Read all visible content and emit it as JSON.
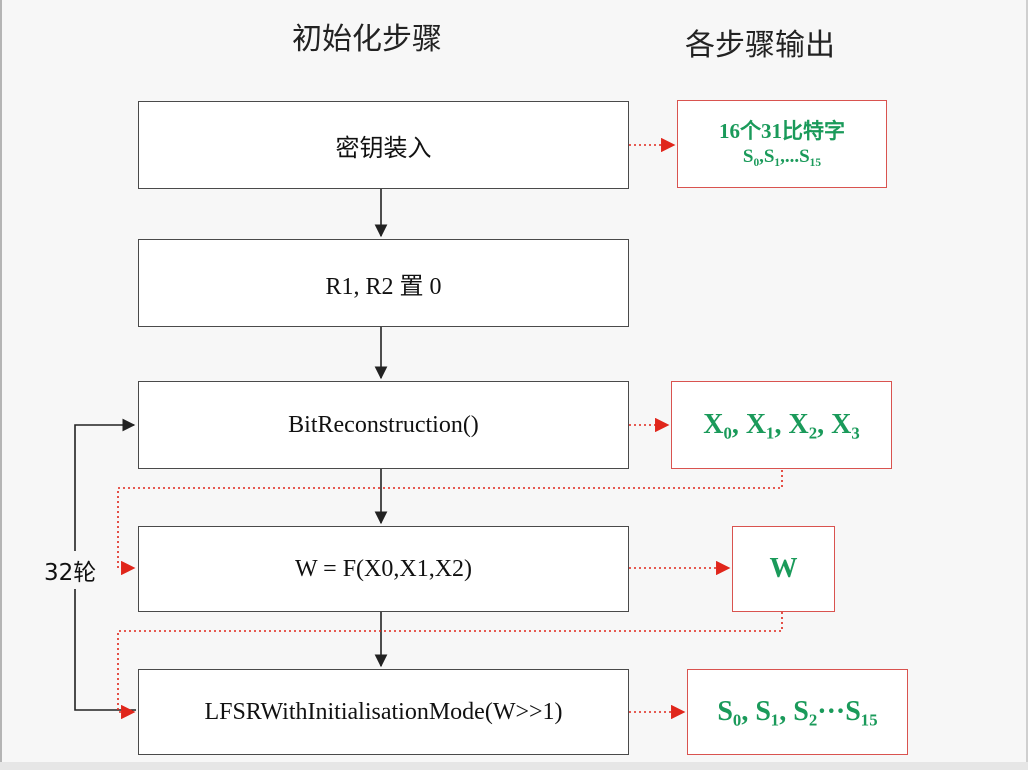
{
  "headings": {
    "steps": "初始化步骤",
    "outputs": "各步骤输出"
  },
  "steps": [
    "密钥装入",
    "R1, R2 置 0",
    "BitReconstruction()",
    "W = F(X0,X1,X2)",
    "LFSRWithInitialisationMode(W>>1)"
  ],
  "outputs": {
    "key_line1": "16个31比特字",
    "key_line2": "S₀,S₁,...S₁₅",
    "bits": "X₀, X₁, X₂, X₃",
    "w": "W",
    "lfsr": "S₀, S₁, S₂···S₁₅"
  },
  "loop_label": "32轮",
  "colors": {
    "flow_arrow": "#222222",
    "output_arrow": "#e0261b",
    "output_border": "#d9534f",
    "output_text": "#1a9a5a"
  }
}
